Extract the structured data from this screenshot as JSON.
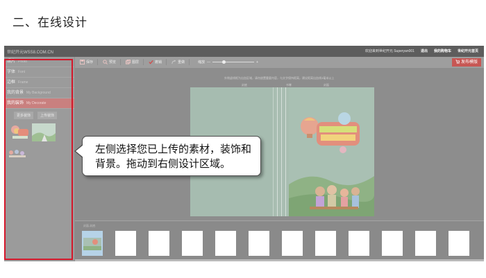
{
  "heading": "二、在线设计",
  "app": {
    "brand": "世纪开元WSS8.COM.CN",
    "topnav": [
      "欢迎来到世纪开元 Superyan001",
      "退出",
      "我的购物车",
      "世纪开元首页"
    ],
    "sidebar": {
      "items": [
        {
          "cn": "照片",
          "en": "Photo"
        },
        {
          "cn": "字体",
          "en": "Font"
        },
        {
          "cn": "边框",
          "en": "Frame"
        },
        {
          "cn": "我的背景",
          "en": "My Background"
        },
        {
          "cn": "我的装饰",
          "en": "My Decorate"
        }
      ],
      "active_index": 4,
      "buttons": [
        "更多装饰",
        "上传装饰"
      ]
    },
    "toolbar": {
      "tools": [
        "保存",
        "预览",
        "图层",
        "撤销",
        "重做"
      ],
      "zoom_label": "缩放",
      "zoom_minus": "—",
      "zoom_plus": "+",
      "publish": "发布模版"
    },
    "canvas": {
      "hint": "外侧虚线框为出血区域，请勿放置重要内容，与文字保持距离，建议距离出血线3毫米以上",
      "labels": [
        "封底",
        "书脊",
        "封面"
      ]
    },
    "filmstrip": {
      "selected_label": "封面-封底"
    }
  },
  "callout": {
    "text": "左侧选择您已上传的素材，装饰和背景。拖动到右侧设计区域。"
  },
  "colors": {
    "highlight_frame": "#d4172a",
    "active_tab": "#c9807f",
    "publish_button": "#c75754"
  }
}
